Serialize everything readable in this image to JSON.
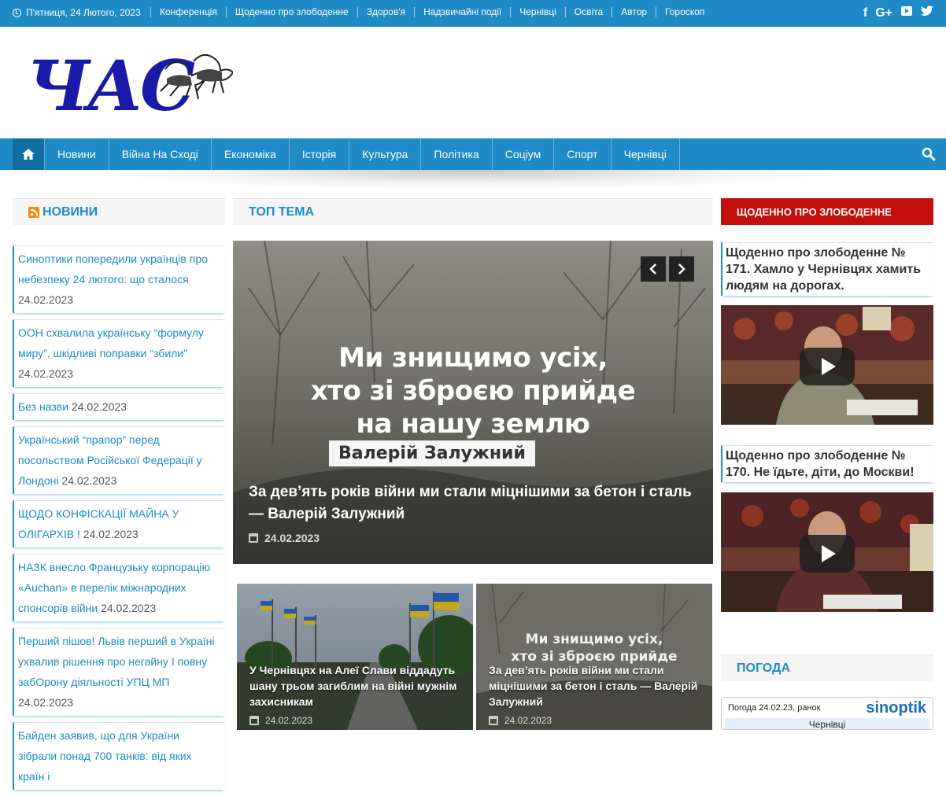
{
  "topbar": {
    "date": "П'ятниця, 24 Лютого, 2023",
    "links": [
      "Конференція",
      "Щоденно про злободенне",
      "Здоров'я",
      "Надзвичайні події",
      "Чернівці",
      "Освіта",
      "Автор",
      "Гороскоп"
    ],
    "social": [
      "facebook-icon",
      "google-plus-icon",
      "youtube-icon",
      "twitter-icon"
    ]
  },
  "logo": {
    "text": "ЧАС"
  },
  "nav": {
    "items": [
      "Новини",
      "Війна На Сході",
      "Економіка",
      "Історія",
      "Культура",
      "Політика",
      "Соціум",
      "Спорт",
      "Чернівці"
    ]
  },
  "left": {
    "heading": "НОВИНИ",
    "items": [
      {
        "title": "Синоптики попередили українців про небезпеку 24 лютого: що сталося",
        "date": "24.02.2023"
      },
      {
        "title": "ООН схвалила українську “формулу миру”, шкідливі поправки “збили”",
        "date": "24.02.2023"
      },
      {
        "title": "Без назви",
        "date": "24.02.2023"
      },
      {
        "title": "Український “прапор” перед посольством Російської Федерації у Лондоні",
        "date": "24.02.2023"
      },
      {
        "title": "ЩОДО КОНФІСКАЦІЇ МАЙНА У ОЛІГАРХІВ !",
        "date": "24.02.2023"
      },
      {
        "title": "НАЗК внесло Французьку корпорацію «Auchan» в перелік міжнародних спонсорів війни",
        "date": "24.02.2023"
      },
      {
        "title": "Перший пішов! Львів перший в Україні ухвалив рішення про негайну І повну забОрону діяльності УПЦ МП",
        "date": "24.02.2023"
      },
      {
        "title": "Байден заявив, що для України зібрали понад 700 танків: від яких країн і",
        "date": ""
      }
    ]
  },
  "center": {
    "heading": "ТОП ТЕМА",
    "hero": {
      "quote": "Ми знищимо усіх,\nхто зі зброєю прийде\nна нашу землю",
      "author": "Валерій Залужний",
      "title": "За дев’ять років війни ми стали міцнішими за бетон і сталь — Валерій Залужний",
      "date": "24.02.2023"
    },
    "cards": [
      {
        "title": "У Чернівцях на Алеї Слави віддадуть шану трьом загиблим на війні мужнім захисникам",
        "date": "24.02.2023"
      },
      {
        "title": "За дев’ять років війни ми стали міцнішими за бетон і сталь — Валерій Залужний",
        "date": "24.02.2023",
        "overlay": "Ми знищимо усіх,\nхто зі зброєю прийде"
      }
    ]
  },
  "right": {
    "heading": "ЩОДЕННО ПРО ЗЛОБОДЕННЕ",
    "items": [
      {
        "title": "Щоденно про злободенне № 171. Хамло у Чернівцях хамить людям на дорогах."
      },
      {
        "title": "Щоденно про злободенне № 170. Не їдьте, діти, до Москви!"
      }
    ],
    "weather_heading": "ПОГОДА",
    "weather": {
      "line": "Погода 24.02.23, ранок",
      "brand": "sinoptik",
      "city": "Чернівці"
    }
  },
  "colors": {
    "accent": "#1e8bc6",
    "daily": "#c40e0e"
  }
}
